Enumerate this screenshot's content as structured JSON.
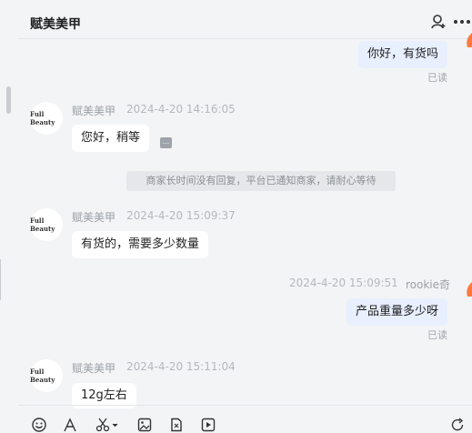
{
  "header": {
    "title": "赋美美甲"
  },
  "messages": [
    {
      "text": "你好，有货吗",
      "status": "已读"
    },
    {
      "sender": "赋美美甲",
      "avatar_text": "Full Beauty",
      "time": "2024-4-20 14:16:05",
      "text": "您好，稍等",
      "emoji": "..."
    },
    {
      "system_note": "商家长时间没有回复，平台已通知商家，请耐心等待"
    },
    {
      "sender": "赋美美甲",
      "avatar_text": "Full Beauty",
      "time": "2024-4-20 15:09:37",
      "text": "有货的，需要多少数量"
    },
    {
      "time": "2024-4-20 15:09:51",
      "sender": "rookie奇",
      "text": "产品重量多少呀",
      "status": "已读"
    },
    {
      "sender": "赋美美甲",
      "avatar_text": "Full Beauty",
      "time": "2024-4-20 15:11:04",
      "text": "12g左右"
    }
  ],
  "colors": {
    "accent": "#ff7a3d",
    "bubble_out": "#e8efff",
    "bubble_in": "#ffffff",
    "background": "#f3f4f6"
  },
  "toolbar_icons": [
    "emoji-icon",
    "font-icon",
    "scissors-icon",
    "image-icon",
    "file-icon",
    "video-icon",
    "refresh-icon"
  ]
}
